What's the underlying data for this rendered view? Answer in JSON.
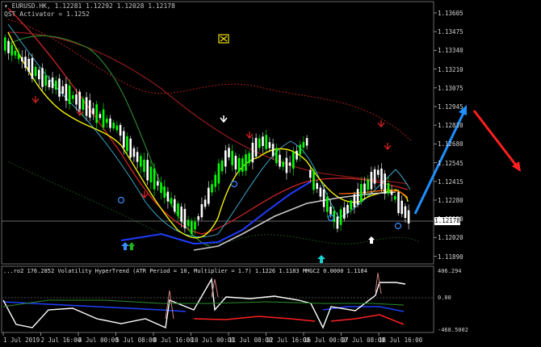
{
  "main_chart": {
    "symbol_info": "EURUSD.HK, 1.12281 1.12292 1.12028 1.12178",
    "indicator_label": "QST Activator = 1.1252",
    "current_price": "1.12178",
    "price_labels": [
      "1.13605",
      "1.13475",
      "1.13340",
      "1.13210",
      "1.13075",
      "1.12945",
      "1.12810",
      "1.12680",
      "1.12545",
      "1.12415",
      "1.12280",
      "1.12150",
      "1.12020",
      "1.11890"
    ]
  },
  "indicator_pane": {
    "title": "...ro2 176.2852  Volatility HyperTrend (ATR Period = 10, Multiplier = 1.7) 1.1226 1.1183  MMGC2 0.0000 1.1184",
    "max_label": "406.294",
    "zero_label": "0.00",
    "min_label": "-468.5002"
  },
  "time_axis": [
    "1 Jul 2019",
    "2 Jul 16:00",
    "4 Jul 00:00",
    "5 Jul 08:00",
    "8 Jul 16:00",
    "10 Jul 00:00",
    "11 Jul 08:00",
    "12 Jul 16:00",
    "16 Jul 00:00",
    "17 Jul 08:00",
    "18 Jul 16:00"
  ],
  "colors": {
    "background": "#000000",
    "bull_candle": "#00ff00",
    "bear_candle": "#ffffff",
    "trend_blue": "#1e3cff",
    "trend_white": "#c8c8c8",
    "ma_yellow": "#ffff00",
    "ma_red": "#ff2020",
    "ma_green": "#2e8b2e",
    "arrow_up_annotation": "#1e90ff",
    "arrow_down_annotation": "#ff2020"
  }
}
